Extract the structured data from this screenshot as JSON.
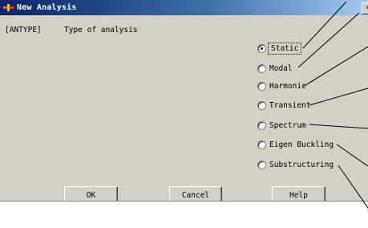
{
  "window": {
    "title": "New Analysis",
    "close_glyph": "×"
  },
  "command": {
    "label": "[ANTYPE]",
    "description": "Type of analysis"
  },
  "analysis_types": [
    {
      "label": "Static",
      "selected": true
    },
    {
      "label": "Modal",
      "selected": false
    },
    {
      "label": "Harmonic",
      "selected": false
    },
    {
      "label": "Transient",
      "selected": false
    },
    {
      "label": "Spectrum",
      "selected": false
    },
    {
      "label": "Eigen Buckling",
      "selected": false
    },
    {
      "label": "Substructuring",
      "selected": false
    }
  ],
  "buttons": {
    "ok": "OK",
    "cancel": "Cancel",
    "help": "Help"
  },
  "colors": {
    "dialog_bg": "#d4d0c8",
    "titlebar_start": "#0a246a",
    "titlebar_end": "#a6caf0",
    "callout_line": "#000000"
  }
}
